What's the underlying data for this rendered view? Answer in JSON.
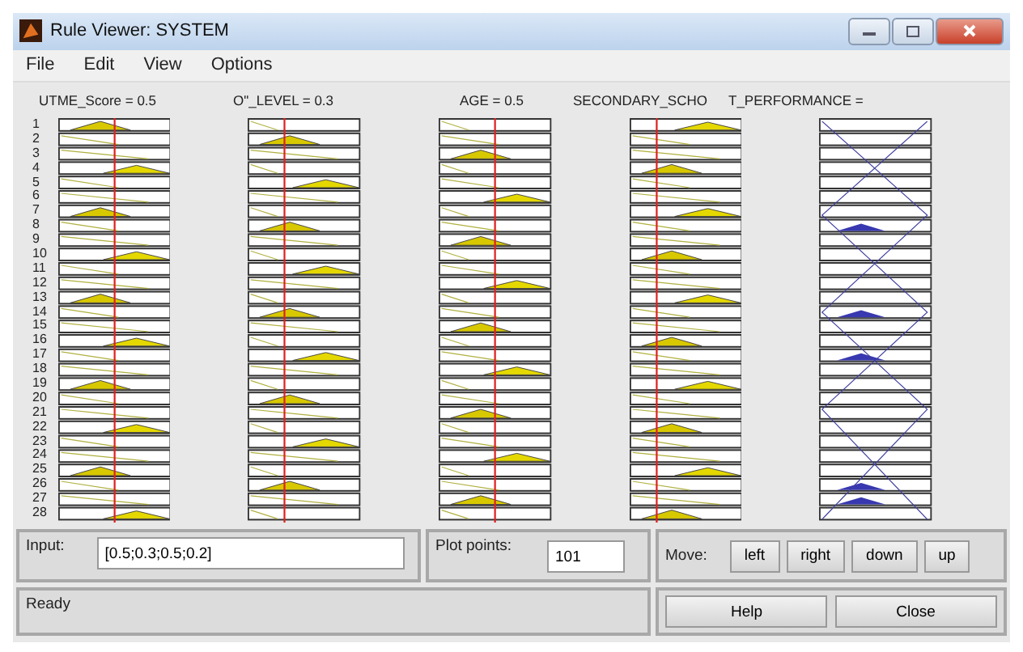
{
  "window": {
    "title": "Rule Viewer: SYSTEM"
  },
  "menu": [
    "File",
    "Edit",
    "View",
    "Options"
  ],
  "variables": [
    {
      "label": "UTME_Score = 0.5",
      "kind": "input"
    },
    {
      "label": "O\"_LEVEL = 0.3",
      "kind": "input"
    },
    {
      "label": "AGE = 0.5",
      "kind": "input"
    },
    {
      "label": "SECONDARY_SCHO",
      "kind": "input"
    },
    {
      "label": "T_PERFORMANCE =",
      "kind": "output"
    }
  ],
  "rule_numbers": [
    "1",
    "2",
    "3",
    "4",
    "5",
    "6",
    "7",
    "8",
    "9",
    "10",
    "11",
    "12",
    "13",
    "14",
    "15",
    "16",
    "17",
    "18",
    "19",
    "20",
    "21",
    "22",
    "23",
    "24",
    "25",
    "26",
    "27",
    "28"
  ],
  "input": {
    "label": "Input:",
    "value": "[0.5;0.3;0.5;0.2]"
  },
  "plot_points": {
    "label": "Plot points:",
    "value": "101"
  },
  "move": {
    "label": "Move:",
    "buttons": [
      "left",
      "right",
      "down",
      "up"
    ]
  },
  "status": "Ready",
  "buttons": [
    "Help",
    "Close"
  ]
}
